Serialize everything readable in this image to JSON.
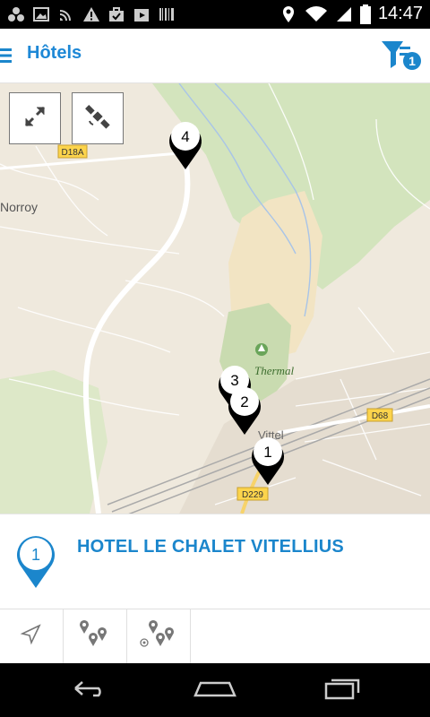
{
  "status_bar": {
    "time": "14:47",
    "icons_left": [
      "app-icon",
      "image-icon",
      "cast-icon",
      "warning-icon",
      "briefcase-icon",
      "play-store-icon",
      "barcode-icon"
    ],
    "icons_right": [
      "location-icon",
      "wifi-icon",
      "signal-icon",
      "battery-icon"
    ]
  },
  "app_bar": {
    "title": "Hôtels",
    "filter_badge_count": "1"
  },
  "map": {
    "road_labels": [
      "D18A",
      "D68",
      "D229"
    ],
    "place_labels": [
      "Norroy",
      "Thermal",
      "Vittel"
    ],
    "markers": [
      "1",
      "2",
      "3",
      "4"
    ],
    "controls": [
      "fullscreen-icon",
      "satellite-icon"
    ]
  },
  "selected_hotel": {
    "number": "1",
    "name": "HOTEL LE CHALET VITELLIUS"
  },
  "tools": [
    "navigate-icon",
    "nearby-pins-icon",
    "my-location-pins-icon"
  ],
  "colors": {
    "accent": "#1b86cc",
    "map_background": "#efe9dd",
    "park": "#cfe0b8"
  }
}
